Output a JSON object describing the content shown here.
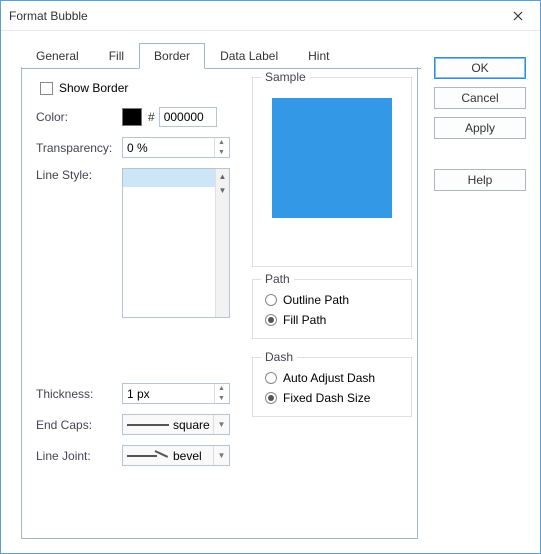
{
  "window": {
    "title": "Format Bubble"
  },
  "tabs": [
    {
      "label": "General"
    },
    {
      "label": "Fill"
    },
    {
      "label": "Border"
    },
    {
      "label": "Data Label"
    },
    {
      "label": "Hint"
    }
  ],
  "active_tab": 2,
  "buttons": {
    "ok": "OK",
    "cancel": "Cancel",
    "apply": "Apply",
    "help": "Help"
  },
  "border_tab": {
    "show_border_label": "Show Border",
    "show_border_checked": false,
    "color_label": "Color:",
    "color_hex": "000000",
    "color_swatch": "#000000",
    "transparency_label": "Transparency:",
    "transparency_value": "0 %",
    "line_style_label": "Line Style:",
    "thickness_label": "Thickness:",
    "thickness_value": "1 px",
    "end_caps_label": "End Caps:",
    "end_caps_value": "square",
    "line_joint_label": "Line Joint:",
    "line_joint_value": "bevel"
  },
  "sample": {
    "legend": "Sample",
    "fill": "#3399e6"
  },
  "path": {
    "legend": "Path",
    "options": [
      {
        "label": "Outline Path",
        "selected": false
      },
      {
        "label": "Fill Path",
        "selected": true
      }
    ]
  },
  "dash": {
    "legend": "Dash",
    "options": [
      {
        "label": "Auto Adjust Dash",
        "selected": false
      },
      {
        "label": "Fixed Dash Size",
        "selected": true
      }
    ]
  }
}
